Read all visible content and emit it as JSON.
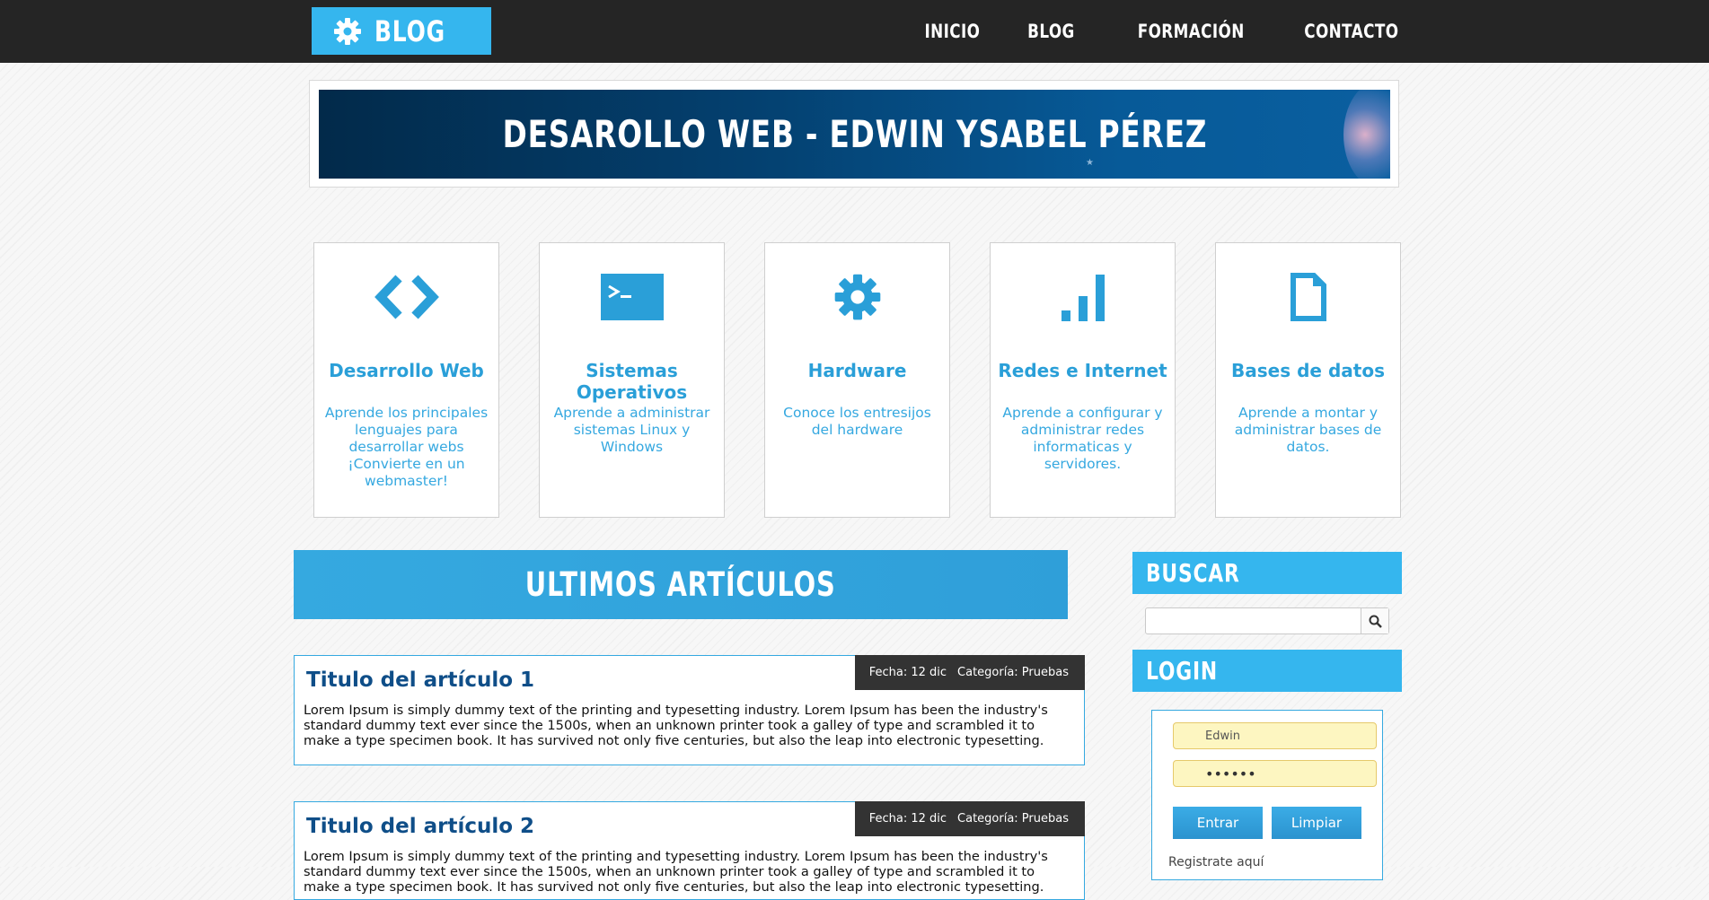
{
  "brand": {
    "label": "BLOG"
  },
  "nav": [
    "INICIO",
    "BLOG",
    "FORMACIÓN",
    "CONTACTO"
  ],
  "banner": {
    "title": "DESAROLLO WEB - EDWIN YSABEL PÉREZ"
  },
  "features": [
    {
      "icon": "code-icon",
      "title": "Desarrollo Web",
      "desc": "Aprende los principales lenguajes para desarrollar webs ¡Convierte en un webmaster!"
    },
    {
      "icon": "terminal-icon",
      "title": "Sistemas Operativos",
      "desc": "Aprende a administrar sistemas Linux y Windows"
    },
    {
      "icon": "gear-icon",
      "title": "Hardware",
      "desc": "Conoce los entresijos del hardware"
    },
    {
      "icon": "signal-bars-icon",
      "title": "Redes e Internet",
      "desc": "Aprende a configurar y administrar redes informaticas y servidores."
    },
    {
      "icon": "document-icon",
      "title": "Bases de datos",
      "desc": "Aprende a montar y administrar bases de datos."
    }
  ],
  "articles_header": "ULTIMOS ARTÍCULOS",
  "articles": [
    {
      "title": "Titulo del artículo 1",
      "date": "Fecha: 12 dic",
      "category": "Categoría: Pruebas",
      "body": "Lorem Ipsum is simply dummy text of the printing and typesetting industry. Lorem Ipsum has been the industry's standard dummy text ever since the 1500s, when an unknown printer took a galley of type and scrambled it to make a type specimen book. It has survived not only five centuries, but also the leap into electronic typesetting."
    },
    {
      "title": "Titulo del artículo 2",
      "date": "Fecha: 12 dic",
      "category": "Categoría: Pruebas",
      "body": "Lorem Ipsum is simply dummy text of the printing and typesetting industry. Lorem Ipsum has been the industry's standard dummy text ever since the 1500s, when an unknown printer took a galley of type and scrambled it to make a type specimen book. It has survived not only five centuries, but also the leap into electronic typesetting."
    }
  ],
  "sidebar": {
    "search_title": "BUSCAR",
    "search_value": "",
    "login_title": "LOGIN",
    "username": "Edwin",
    "password_mask": "••••••",
    "enter_label": "Entrar",
    "clear_label": "Limpiar",
    "register_label": "Registrate aquí"
  },
  "colors": {
    "accent": "#35b6ee",
    "topbar": "#252525",
    "title_blue": "#0f4e88"
  }
}
